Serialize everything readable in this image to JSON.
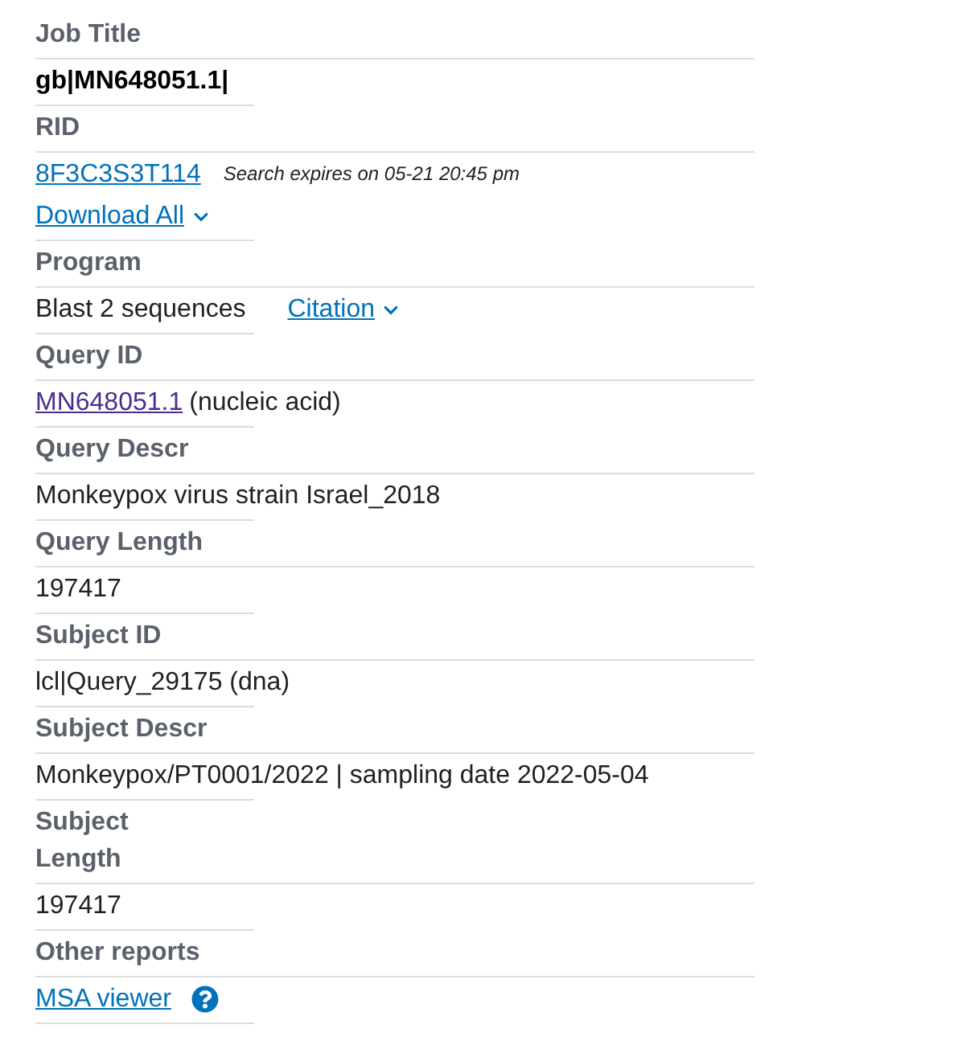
{
  "fields": [
    {
      "label": "Job Title",
      "values": [
        {
          "kind": "strong",
          "text": "gb|MN648051.1|"
        }
      ]
    },
    {
      "label": "RID",
      "values": [
        {
          "kind": "link",
          "text": "8F3C3S3T114",
          "visited": false,
          "note": "Search expires on 05-21 20:45 pm"
        },
        {
          "kind": "dropdown-link",
          "text": "Download All"
        }
      ]
    },
    {
      "label": "Program",
      "values": [
        {
          "kind": "text-with-dropdown",
          "text": "Blast 2 sequences",
          "link": "Citation"
        }
      ]
    },
    {
      "label": "Query ID",
      "values": [
        {
          "kind": "link",
          "text": "MN648051.1",
          "visited": true,
          "suffix": "(nucleic acid)"
        }
      ]
    },
    {
      "label": "Query Descr",
      "values": [
        {
          "kind": "text",
          "text": "Monkeypox virus strain Israel_2018"
        }
      ]
    },
    {
      "label": "Query Length",
      "values": [
        {
          "kind": "text",
          "text": "197417"
        }
      ]
    },
    {
      "label": "Subject ID",
      "values": [
        {
          "kind": "text",
          "text": "lcl|Query_29175 (dna)"
        }
      ]
    },
    {
      "label": "Subject Descr",
      "values": [
        {
          "kind": "text",
          "text": "Monkeypox/PT0001/2022 | sampling date 2022-05-04"
        }
      ]
    },
    {
      "label": "Subject Length",
      "values": [
        {
          "kind": "text",
          "text": "197417"
        }
      ]
    },
    {
      "label": "Other reports",
      "values": [
        {
          "kind": "help-link",
          "text": "MSA viewer"
        }
      ]
    }
  ]
}
